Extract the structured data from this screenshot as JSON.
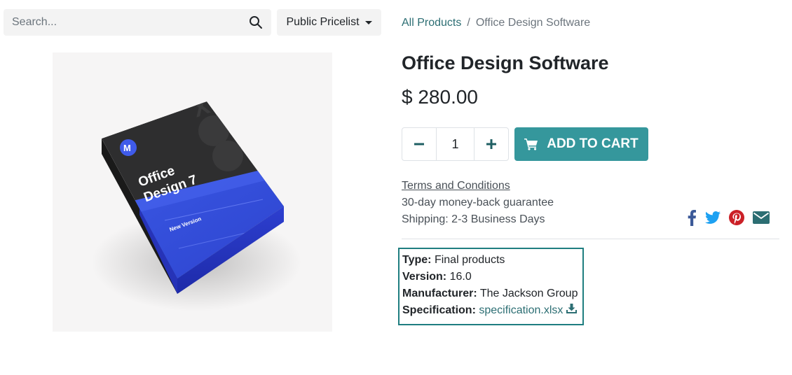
{
  "search": {
    "placeholder": "Search..."
  },
  "pricelist": {
    "label": "Public Pricelist"
  },
  "breadcrumb": {
    "parent": "All Products",
    "separator": "/",
    "current": "Office Design Software"
  },
  "product": {
    "name": "Office Design Software",
    "price": "$ 280.00",
    "quantity": "1",
    "add_to_cart": "ADD TO CART",
    "box_text": {
      "line1": "Office",
      "line2": "Design 7",
      "badge": "New Version"
    }
  },
  "terms": {
    "link": "Terms and Conditions",
    "guarantee": "30-day money-back guarantee",
    "shipping": "Shipping: 2-3 Business Days"
  },
  "social": {
    "icons": [
      "facebook-icon",
      "twitter-icon",
      "pinterest-icon",
      "email-icon"
    ]
  },
  "attributes": {
    "type_label": "Type:",
    "type_value": "Final products",
    "version_label": "Version:",
    "version_value": "16.0",
    "manufacturer_label": "Manufacturer:",
    "manufacturer_value": "The Jackson Group",
    "spec_label": "Specification:",
    "spec_value": "specification.xlsx"
  },
  "colors": {
    "accent": "#35979c",
    "link": "#2c6e73",
    "highlight_border": "#1f7e80",
    "facebook": "#3b5998",
    "twitter": "#1da1f2",
    "pinterest": "#cb2027",
    "email": "#2c6e73"
  }
}
